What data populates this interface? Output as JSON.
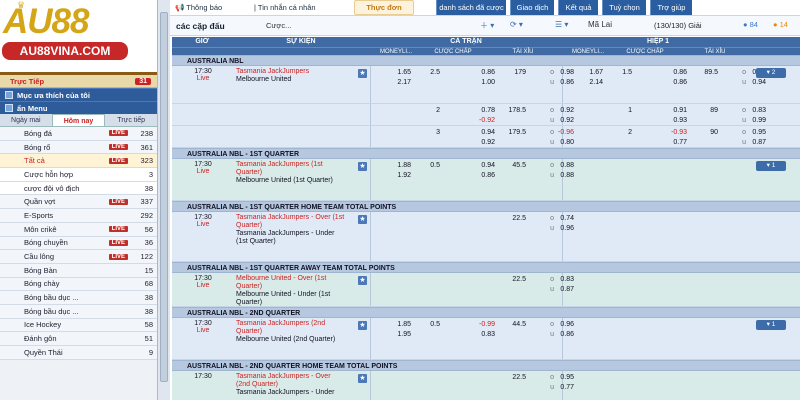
{
  "brand": {
    "logo_text": "AU88",
    "site_label": "AU88VINA.COM"
  },
  "live": {
    "label": "Trực Tiếp",
    "count": "31"
  },
  "favorites_label": "Mục ưa thích của tôi",
  "hide_menu_label": "ẩn Menu",
  "tabs": [
    "Ngày mai",
    "Hôm nay",
    "Trực tiếp"
  ],
  "sports": [
    {
      "name": "Bóng đá",
      "live": true,
      "count": "238",
      "type": "main"
    },
    {
      "name": "Bóng rổ",
      "live": true,
      "count": "361",
      "type": "main"
    },
    {
      "name": "Tất cả",
      "live": true,
      "count": "323",
      "type": "sel"
    },
    {
      "name": "Cược hỗn hợp",
      "live": false,
      "count": "3",
      "type": "sub"
    },
    {
      "name": "cược đội vô địch",
      "live": false,
      "count": "38",
      "type": "sub"
    },
    {
      "name": "Quần vợt",
      "live": true,
      "count": "337",
      "type": "main"
    },
    {
      "name": "E-Sports",
      "live": false,
      "count": "292",
      "type": "main"
    },
    {
      "name": "Môn crikê",
      "live": true,
      "count": "56",
      "type": "main"
    },
    {
      "name": "Bóng chuyền",
      "live": true,
      "count": "36",
      "type": "main"
    },
    {
      "name": "Cầu lông",
      "live": true,
      "count": "122",
      "type": "main"
    },
    {
      "name": "Bóng Bàn",
      "live": false,
      "count": "15",
      "type": "main"
    },
    {
      "name": "Bóng chày",
      "live": false,
      "count": "68",
      "type": "main"
    },
    {
      "name": "Bóng bầu dục ...",
      "live": false,
      "count": "38",
      "type": "main"
    },
    {
      "name": "Bóng bầu dục ...",
      "live": false,
      "count": "38",
      "type": "main"
    },
    {
      "name": "Ice Hockey",
      "live": false,
      "count": "58",
      "type": "main"
    },
    {
      "name": "Đánh gôn",
      "live": false,
      "count": "51",
      "type": "main"
    },
    {
      "name": "Quyền Thái",
      "live": false,
      "count": "9",
      "type": "main"
    }
  ],
  "topbar": {
    "notice": "Thông báo",
    "notice_badge": "NEW",
    "messages": "Tin nhắn cá nhân",
    "menu": "Thực đơn",
    "buttons": [
      "danh sách đã cược",
      "Giao dịch",
      "Kết quả",
      "Tuỳ chọn",
      "Trợ giúp"
    ]
  },
  "filter": {
    "title": "các cặp đấu",
    "select": "Cược...",
    "market": "Mã Lai",
    "count": "(130/130) Giải",
    "green_count": "84",
    "orange_count": "14"
  },
  "header": {
    "time": "GIỜ",
    "event": "SỰ KIỆN",
    "full": "CẢ TRẬN",
    "half": "HIỆP 1",
    "sub": [
      "MONEYLI...",
      "CƯỢC CHẤP",
      "TÀI XỈU",
      "MONEYLI...",
      "CƯỢC CHẤP",
      "TÀI XỈU"
    ]
  },
  "sections": [
    {
      "league": "AUSTRALIA NBL",
      "rows": [
        {
          "time": "17:30",
          "live": "Live",
          "home": "Tasmania JackJumpers",
          "away": "Melbourne United",
          "more": "▾ 2",
          "h": 38,
          "lines": [
            [
              "1.65",
              "2.5",
              "0.86",
              "179",
              "o",
              "0.98",
              "1.67",
              "1.5",
              "0.86",
              "89.5",
              "o",
              "0.88"
            ],
            [
              "2.17",
              "",
              "1.00",
              "",
              "u",
              "0.86",
              "2.14",
              "",
              "0.86",
              "",
              "u",
              "0.94"
            ]
          ]
        },
        {
          "time": "",
          "live": "",
          "home": "",
          "away": "",
          "more": "",
          "h": 22,
          "lines": [
            [
              "",
              "2",
              "0.78",
              "178.5",
              "o",
              "0.92",
              "",
              "1",
              "0.91",
              "89",
              "o",
              "0.83"
            ],
            [
              "",
              "",
              "-0.92",
              "",
              "u",
              "0.92",
              "",
              "",
              "0.93",
              "",
              "u",
              "0.99"
            ]
          ]
        },
        {
          "time": "",
          "live": "",
          "home": "",
          "away": "",
          "more": "",
          "h": 22,
          "lines": [
            [
              "",
              "3",
              "0.94",
              "179.5",
              "o",
              "-0.96",
              "",
              "2",
              "-0.93",
              "90",
              "o",
              "0.95"
            ],
            [
              "",
              "",
              "0.92",
              "",
              "u",
              "0.80",
              "",
              "",
              "0.77",
              "",
              "u",
              "0.87"
            ]
          ]
        }
      ]
    },
    {
      "league": "AUSTRALIA NBL - 1ST QUARTER",
      "rows": [
        {
          "time": "17:30",
          "live": "Live",
          "home": "Tasmania JackJumpers (1st Quarter)",
          "away": "Melbourne United (1st Quarter)",
          "more": "▾ 1",
          "h": 42,
          "lines": [
            [
              "1.88",
              "0.5",
              "0.94",
              "45.5",
              "o",
              "0.88",
              "",
              "",
              "",
              "",
              "",
              ""
            ],
            [
              "1.92",
              "",
              "0.86",
              "",
              "u",
              "0.88",
              "",
              "",
              "",
              "",
              "",
              ""
            ]
          ]
        }
      ]
    },
    {
      "league": "AUSTRALIA NBL - 1ST QUARTER HOME TEAM TOTAL POINTS",
      "rows": [
        {
          "time": "17:30",
          "live": "Live",
          "home": "Tasmania JackJumpers - Over (1st Quarter)",
          "away": "Tasmania JackJumpers - Under (1st Quarter)",
          "more": "",
          "h": 50,
          "lines": [
            [
              "",
              "",
              "",
              "22.5",
              "o",
              "0.74",
              "",
              "",
              "",
              "",
              "",
              ""
            ],
            [
              "",
              "",
              "",
              "",
              "u",
              "0.96",
              "",
              "",
              "",
              "",
              "",
              ""
            ]
          ]
        }
      ]
    },
    {
      "league": "AUSTRALIA NBL - 1ST QUARTER AWAY TEAM TOTAL POINTS",
      "rows": [
        {
          "time": "17:30",
          "live": "Live",
          "home": "Melbourne United - Over (1st Quarter)",
          "away": "Melbourne United - Under (1st Quarter)",
          "more": "",
          "h": 34,
          "lines": [
            [
              "",
              "",
              "",
              "22.5",
              "o",
              "0.83",
              "",
              "",
              "",
              "",
              "",
              ""
            ],
            [
              "",
              "",
              "",
              "",
              "u",
              "0.87",
              "",
              "",
              "",
              "",
              "",
              ""
            ]
          ]
        }
      ]
    },
    {
      "league": "AUSTRALIA NBL - 2ND QUARTER",
      "rows": [
        {
          "time": "17:30",
          "live": "Live",
          "home": "Tasmania JackJumpers (2nd Quarter)",
          "away": "Melbourne United (2nd Quarter)",
          "more": "▾ 1",
          "h": 42,
          "lines": [
            [
              "1.85",
              "0.5",
              "-0.99",
              "44.5",
              "o",
              "0.96",
              "",
              "",
              "",
              "",
              "",
              ""
            ],
            [
              "1.95",
              "",
              "0.83",
              "",
              "u",
              "0.86",
              "",
              "",
              "",
              "",
              "",
              ""
            ]
          ]
        }
      ]
    },
    {
      "league": "AUSTRALIA NBL - 2ND QUARTER HOME TEAM TOTAL POINTS",
      "rows": [
        {
          "time": "17:30",
          "live": "",
          "home": "Tasmania JackJumpers - Over (2nd Quarter)",
          "away": "Tasmania JackJumpers - Under",
          "more": "",
          "h": 40,
          "lines": [
            [
              "",
              "",
              "",
              "22.5",
              "o",
              "0.95",
              "",
              "",
              "",
              "",
              "",
              ""
            ],
            [
              "",
              "",
              "",
              "",
              "u",
              "0.77",
              "",
              "",
              "",
              "",
              "",
              ""
            ]
          ]
        }
      ]
    }
  ],
  "colors": {
    "brand_red": "#c62828",
    "gold": "#d4a516",
    "header_blue": "#3f6aa3"
  }
}
